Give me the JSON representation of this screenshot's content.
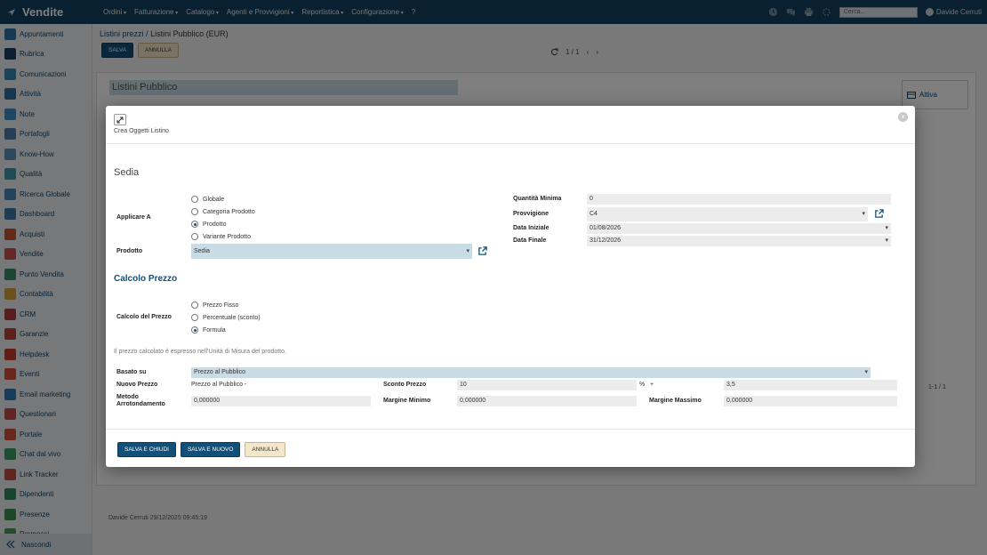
{
  "app": {
    "title": "Vendite"
  },
  "topmenu": [
    "Ordini",
    "Fatturazione",
    "Catalogo",
    "Agenti e Provvigioni",
    "Reportistica",
    "Configurazione"
  ],
  "help_label": "?",
  "search": {
    "placeholder": "Cerca..."
  },
  "user": {
    "name": "Davide Cerruti"
  },
  "sidebar": {
    "items": [
      {
        "label": "Appuntamenti",
        "color": "#2e74a6"
      },
      {
        "label": "Rubrica",
        "color": "#1b3f63"
      },
      {
        "label": "Comunicazioni",
        "color": "#2f86b8"
      },
      {
        "label": "Attività",
        "color": "#2c6fa5"
      },
      {
        "label": "Note",
        "color": "#3f8fc6"
      },
      {
        "label": "Portafogli",
        "color": "#4d7fae"
      },
      {
        "label": "Know-How",
        "color": "#5a8fbf"
      },
      {
        "label": "Qualità",
        "color": "#3a98b0"
      },
      {
        "label": "Ricerca Globale",
        "color": "#4a86b4"
      },
      {
        "label": "Dashboard",
        "color": "#3f78a8"
      },
      {
        "label": "Acquisti",
        "color": "#c6562f"
      },
      {
        "label": "Vendite",
        "color": "#d04f4f"
      },
      {
        "label": "Punto Vendita",
        "color": "#3b8a6c"
      },
      {
        "label": "Contabilità",
        "color": "#d6a23a"
      },
      {
        "label": "CRM",
        "color": "#b23a3a"
      },
      {
        "label": "Garanzie",
        "color": "#b8433a"
      },
      {
        "label": "Helpdesk",
        "color": "#c0392b"
      },
      {
        "label": "Eventi",
        "color": "#d44a3a"
      },
      {
        "label": "Email marketing",
        "color": "#2f7ab8"
      },
      {
        "label": "Questionari",
        "color": "#c54a4a"
      },
      {
        "label": "Portale",
        "color": "#d0503a"
      },
      {
        "label": "Chat dal vivo",
        "color": "#3b9b6a"
      },
      {
        "label": "Link Tracker",
        "color": "#c24d3a"
      },
      {
        "label": "Dipendenti",
        "color": "#2f8a5a"
      },
      {
        "label": "Presenze",
        "color": "#3d8f50"
      },
      {
        "label": "Permessi",
        "color": "#4a9a5a"
      }
    ],
    "collapse_label": "Nascondi"
  },
  "breadcrumb": {
    "parent": "Listini prezzi",
    "sep": "/",
    "current": "Listini Pubblico (EUR)"
  },
  "toolbar": {
    "save_label": "SALVA",
    "cancel_label": "ANNULLA"
  },
  "pager": {
    "value": "1 / 1"
  },
  "sheet": {
    "name": "Listini Pubblico",
    "status": "Attiva",
    "pager2": "1-1 / 1"
  },
  "meta": {
    "text": "Davide Cerruti 29/12/2025 09:45:19"
  },
  "modal": {
    "title": "Crea Oggetti Listino",
    "record_name": "Sedia",
    "applica_label": "Applicare A",
    "applica_options": [
      {
        "label": "Globale",
        "checked": false
      },
      {
        "label": "Categoria Prodotto",
        "checked": false
      },
      {
        "label": "Prodotto",
        "checked": true
      },
      {
        "label": "Variante Prodotto",
        "checked": false
      }
    ],
    "prodotto_label": "Prodotto",
    "prodotto_value": "Sedia",
    "quantita_label": "Quantità Minima",
    "quantita_value": "0",
    "provvigione_label": "Provvigione",
    "provvigione_value": "C4",
    "data_iniziale_label": "Data Iniziale",
    "data_iniziale_value": "01/08/2026",
    "data_finale_label": "Data Finale",
    "data_finale_value": "31/12/2026",
    "section_title": "Calcolo Prezzo",
    "calcolo_label": "Calcolo del Prezzo",
    "calcolo_options": [
      {
        "label": "Prezzo Fisso",
        "checked": false
      },
      {
        "label": "Percentuale (sconto)",
        "checked": false
      },
      {
        "label": "Formula",
        "checked": true
      }
    ],
    "hint": "Il prezzo calcolato è espresso nell'Unità di Misura del prodotto.",
    "basato_label": "Basato su",
    "basato_value": "Prezzo al Pubblico",
    "nuovo_prezzo_label": "Nuovo Prezzo",
    "nuovo_prezzo_value": "Prezzo al Pubblico -",
    "sconto_label": "Sconto Prezzo",
    "sconto_value": "10",
    "percent_label": "%",
    "plus_label": "+",
    "surcharge_value": "3,5",
    "metodo_label_1": "Metodo",
    "metodo_label_2": "Arrotondamento",
    "metodo_value": "0,000000",
    "margine_min_label": "Margine Minimo",
    "margine_min_value": "0,000000",
    "margine_max_label": "Margine Massimo",
    "margine_max_value": "0,000000",
    "btn_save_close": "SALVA E CHIUDI",
    "btn_save_new": "SALVA E NUOVO",
    "btn_cancel": "ANNULLA"
  }
}
